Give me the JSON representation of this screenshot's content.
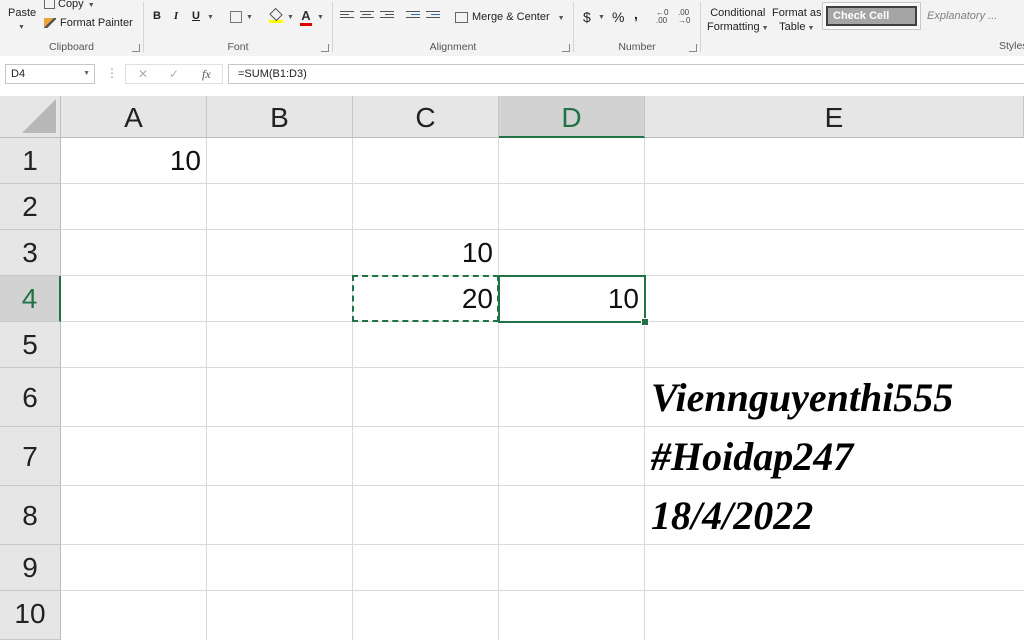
{
  "ribbon": {
    "clipboard": {
      "paste": "Paste",
      "copy": "Copy",
      "format_painter": "Format Painter",
      "label": "Clipboard"
    },
    "font": {
      "bold": "B",
      "italic": "I",
      "underline": "U",
      "label": "Font"
    },
    "alignment": {
      "merge_center": "Merge & Center",
      "label": "Alignment"
    },
    "number": {
      "currency": "$",
      "percent": "%",
      "comma": ",",
      "label": "Number"
    },
    "styles": {
      "conditional_line1": "Conditional",
      "conditional_line2": "Formatting",
      "format_table_line1": "Format as",
      "format_table_line2": "Table",
      "check_cell": "Check Cell",
      "explanatory": "Explanatory ...",
      "label": "Styles"
    }
  },
  "formula_bar": {
    "name_box": "D4",
    "formula": "=SUM(B1:D3)",
    "cancel": "✕",
    "enter": "✓",
    "fx": "fx"
  },
  "sheet": {
    "columns": [
      "A",
      "B",
      "C",
      "D",
      "E"
    ],
    "rows": [
      "1",
      "2",
      "3",
      "4",
      "5",
      "6",
      "7",
      "8",
      "9",
      "10"
    ],
    "cells": {
      "A1": "10",
      "C3": "10",
      "C4": "20",
      "D4": "10"
    },
    "notes": [
      "Viennguyenthi555",
      "#Hoidap247",
      "18/4/2022"
    ]
  },
  "colors": {
    "accent": "#217346",
    "header_bg": "#e6e6e6",
    "ribbon_bg": "#f3f3f3"
  }
}
